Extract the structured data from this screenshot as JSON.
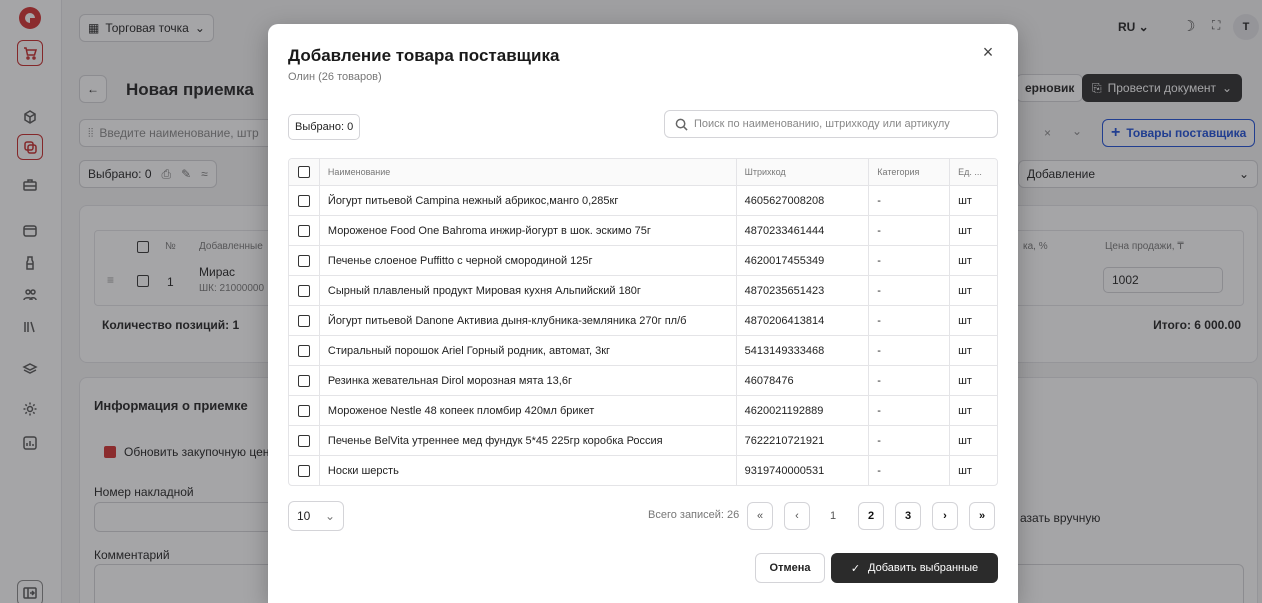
{
  "topbar": {
    "store_label": "Торговая точка",
    "lang": "RU",
    "avatar": "T"
  },
  "page": {
    "title": "Новая приемка",
    "draft_label": "ерновик",
    "conduct_label": "Провести документ"
  },
  "background": {
    "search_placeholder": "Введите наименование, штр",
    "supplier_goods_label": "Товары поставщика",
    "selected_label": "Выбрано: 0",
    "add_mode": "Добавление",
    "table_headers": [
      "№",
      "Добавленные",
      "ка, %",
      "Цена продажи, ₸"
    ],
    "row": {
      "num": "1",
      "name": "Мирас",
      "barcode": "ШК: 21000000",
      "price": "1002"
    },
    "positions_label": "Количество позиций:",
    "positions_count": "1",
    "total_label": "Итого:",
    "total_value": "6 000.00",
    "info_title": "Информация о приемке",
    "update_label": "Обновить закупочную цен",
    "invoice_label": "Номер накладной",
    "manual_label": "азать вручную",
    "comment_label": "Комментарий"
  },
  "modal": {
    "title": "Добавление товара поставщика",
    "subtitle": "Олин (26 товаров)",
    "selected": "Выбрано: 0",
    "search_placeholder": "Поиск по наименованию, штрихкоду или артикулу",
    "columns": {
      "name": "Наименование",
      "barcode": "Штрихкод",
      "category": "Категория",
      "unit": "Ед. ..."
    },
    "rows": [
      {
        "name": "Йогурт питьевой Campina нежный абрикос,манго 0,285кг",
        "barcode": "4605627008208",
        "category": "-",
        "unit": "шт"
      },
      {
        "name": "Мороженое Food One Bahroma инжир-йогурт в шок. эскимо 75г",
        "barcode": "4870233461444",
        "category": "-",
        "unit": "шт"
      },
      {
        "name": "Печенье слоеное Puffitto с черной смородиной 125г",
        "barcode": "4620017455349",
        "category": "-",
        "unit": "шт"
      },
      {
        "name": "Сырный плавленый продукт Мировая кухня Альпийский 180г",
        "barcode": "4870235651423",
        "category": "-",
        "unit": "шт"
      },
      {
        "name": "Йогурт питьевой Danone Активиа дыня-клубника-земляника 270г пл/б",
        "barcode": "4870206413814",
        "category": "-",
        "unit": "шт"
      },
      {
        "name": "Стиральный порошок Ariel Горный родник, автомат, 3кг",
        "barcode": "5413149333468",
        "category": "-",
        "unit": "шт"
      },
      {
        "name": "Резинка жевательная Dirol морозная мята 13,6г",
        "barcode": "46078476",
        "category": "-",
        "unit": "шт"
      },
      {
        "name": "Мороженое Nestle 48 копеек пломбир 420мл брикет",
        "barcode": "4620021192889",
        "category": "-",
        "unit": "шт"
      },
      {
        "name": "Печенье BelVita утреннее мед фундук 5*45 225гр коробка Россия",
        "barcode": "7622210721921",
        "category": "-",
        "unit": "шт"
      },
      {
        "name": "Носки шерсть",
        "barcode": "9319740000531",
        "category": "-",
        "unit": "шт"
      }
    ],
    "page_size": "10",
    "total_records": "Всего записей: 26",
    "pages": [
      "1",
      "2",
      "3"
    ],
    "cancel": "Отмена",
    "add_selected": "Добавить выбранные"
  }
}
